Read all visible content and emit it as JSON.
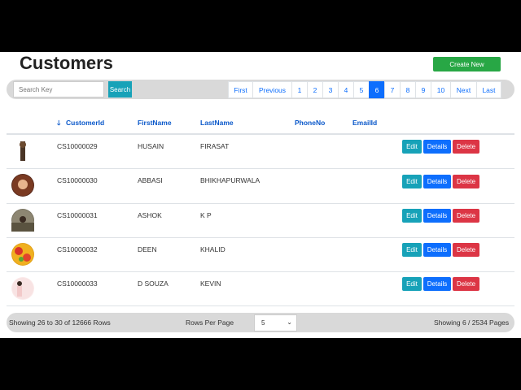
{
  "title": "Customers",
  "create_label": "Create New",
  "search": {
    "placeholder": "Search Key",
    "button": "Search"
  },
  "pagination": [
    "First",
    "Previous",
    "1",
    "2",
    "3",
    "4",
    "5",
    "6",
    "7",
    "8",
    "9",
    "10",
    "Next",
    "Last"
  ],
  "active_page": "6",
  "columns": {
    "sort_arrow": "🡓",
    "customer_id": "CustomerId",
    "first_name": "FirstName",
    "last_name": "LastName",
    "phone": "PhoneNo",
    "email": "EmailId"
  },
  "actions": {
    "edit": "Edit",
    "details": "Details",
    "delete": "Delete"
  },
  "rows": [
    {
      "id": "CS10000029",
      "first": "HUSAIN",
      "last": "FIRASAT"
    },
    {
      "id": "CS10000030",
      "first": "ABBASI",
      "last": "BHIKHAPURWALA"
    },
    {
      "id": "CS10000031",
      "first": "ASHOK",
      "last": "K P"
    },
    {
      "id": "CS10000032",
      "first": "DEEN",
      "last": "KHALID"
    },
    {
      "id": "CS10000033",
      "first": "D SOUZA",
      "last": "KEVIN"
    }
  ],
  "footer": {
    "rows_info": "Showing 26 to 30 of 12666 Rows",
    "rows_per_page_label": "Rows Per Page",
    "rows_per_page_value": "5",
    "pages_info": "Showing 6 / 2534 Pages"
  }
}
